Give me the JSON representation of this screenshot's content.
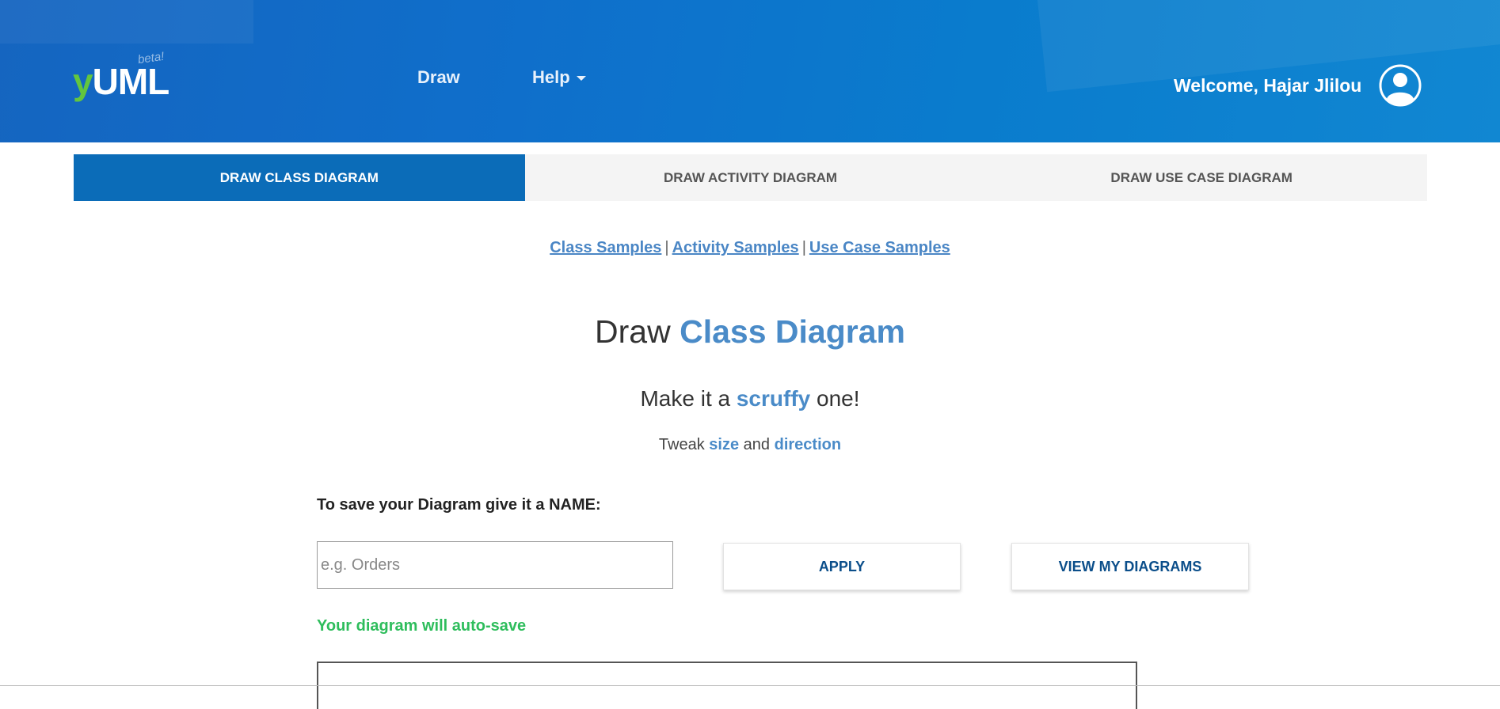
{
  "header": {
    "logo": {
      "y": "y",
      "uml": "UML",
      "beta": "beta!"
    },
    "nav": {
      "draw": "Draw",
      "help": "Help"
    },
    "welcome": "Welcome, Hajar Jlilou",
    "avatar_icon": "user-avatar-icon"
  },
  "tabs": [
    {
      "label": "DRAW CLASS DIAGRAM",
      "active": true
    },
    {
      "label": "DRAW ACTIVITY DIAGRAM",
      "active": false
    },
    {
      "label": "DRAW USE CASE DIAGRAM",
      "active": false
    }
  ],
  "samples": {
    "class": "Class Samples",
    "activity": "Activity Samples",
    "use_case": "Use Case Samples",
    "separator": "|"
  },
  "main": {
    "title_prefix": "Draw",
    "title_accent": "Class Diagram",
    "subtitle_prefix": "Make it a",
    "subtitle_accent": "scruffy",
    "subtitle_suffix": "one!",
    "tweak_prefix": "Tweak",
    "tweak_size": "size",
    "tweak_and": "and",
    "tweak_direction": "direction"
  },
  "form": {
    "save_label": "To save your Diagram give it a NAME:",
    "name_placeholder": "e.g. Orders",
    "name_value": "",
    "apply_label": "APPLY",
    "view_label": "VIEW MY DIAGRAMS",
    "autosave": "Your diagram will auto-save"
  },
  "colors": {
    "header_blue": "#0f6fcb",
    "tab_active": "#0b6cb8",
    "accent": "#4a8bc8",
    "logo_green": "#63c63e",
    "autosave_green": "#2ebd5c"
  }
}
